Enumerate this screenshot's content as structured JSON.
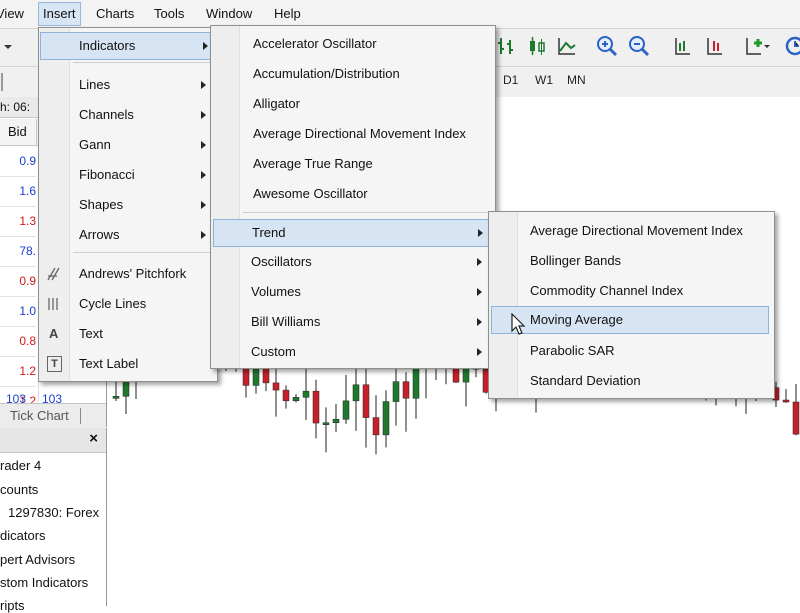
{
  "menubar": {
    "items": [
      "View",
      "Insert",
      "Charts",
      "Tools",
      "Window",
      "Help"
    ],
    "active": "Insert"
  },
  "toolbar": {
    "icons": [
      "bar-chart-icon",
      "candlestick-icon",
      "line-chart-icon",
      "zoom-in-icon",
      "zoom-out-icon",
      "chart-shift-icon",
      "autoscroll-icon",
      "add-indicator-icon",
      "period-icon"
    ]
  },
  "timeframes": [
    "D1",
    "W1",
    "MN"
  ],
  "market_watch": {
    "header_partial": "h: 06:",
    "column": "Bid",
    "rows": [
      {
        "text": "0.9",
        "color": "#1a3fd0"
      },
      {
        "text": "1.6",
        "color": "#1a3fd0"
      },
      {
        "text": "1.3",
        "color": "#d21a1a"
      },
      {
        "text": "78.",
        "color": "#1a3fd0"
      },
      {
        "text": "0.9",
        "color": "#d21a1a"
      },
      {
        "text": "1.0",
        "color": "#1a3fd0"
      },
      {
        "text": "0.8",
        "color": "#d21a1a"
      },
      {
        "text": "1.2",
        "color": "#d21a1a"
      },
      {
        "text": "1.2",
        "color": "#d21a1a"
      }
    ],
    "bottom_values": [
      "103",
      "103"
    ],
    "tab": "Tick Chart"
  },
  "navigator": {
    "items": [
      "rader 4",
      "counts",
      "1297830: Forex",
      "dicators",
      "pert Advisors",
      "stom Indicators",
      "ripts"
    ]
  },
  "insert_menu": {
    "items": [
      {
        "label": "Indicators",
        "submenu": true,
        "highlighted": true
      },
      {
        "label": "Lines",
        "submenu": true
      },
      {
        "label": "Channels",
        "submenu": true
      },
      {
        "label": "Gann",
        "submenu": true
      },
      {
        "label": "Fibonacci",
        "submenu": true
      },
      {
        "label": "Shapes",
        "submenu": true
      },
      {
        "label": "Arrows",
        "submenu": true
      },
      {
        "label": "Andrews' Pitchfork",
        "icon": "pitchfork-icon"
      },
      {
        "label": "Cycle Lines",
        "icon": "cycle-lines-icon"
      },
      {
        "label": "Text",
        "icon": "text-icon",
        "glyph": "A"
      },
      {
        "label": "Text Label",
        "icon": "text-label-icon",
        "glyph": "T"
      }
    ]
  },
  "indicators_menu": {
    "items": [
      {
        "label": "Accelerator Oscillator"
      },
      {
        "label": "Accumulation/Distribution"
      },
      {
        "label": "Alligator"
      },
      {
        "label": "Average Directional Movement Index"
      },
      {
        "label": "Average True Range"
      },
      {
        "label": "Awesome Oscillator"
      },
      {
        "label": "Trend",
        "submenu": true,
        "highlighted": true
      },
      {
        "label": "Oscillators",
        "submenu": true
      },
      {
        "label": "Volumes",
        "submenu": true
      },
      {
        "label": "Bill Williams",
        "submenu": true
      },
      {
        "label": "Custom",
        "submenu": true
      }
    ]
  },
  "trend_menu": {
    "items": [
      {
        "label": "Average Directional Movement Index"
      },
      {
        "label": "Bollinger Bands"
      },
      {
        "label": "Commodity Channel Index"
      },
      {
        "label": "Moving Average",
        "highlighted": true
      },
      {
        "label": "Parabolic SAR"
      },
      {
        "label": "Standard Deviation"
      }
    ]
  },
  "colors": {
    "bull_candle": "#1f7a2e",
    "bear_candle": "#c8202b",
    "highlight": "#d6e4f4",
    "highlight_border": "#8fb2db"
  }
}
